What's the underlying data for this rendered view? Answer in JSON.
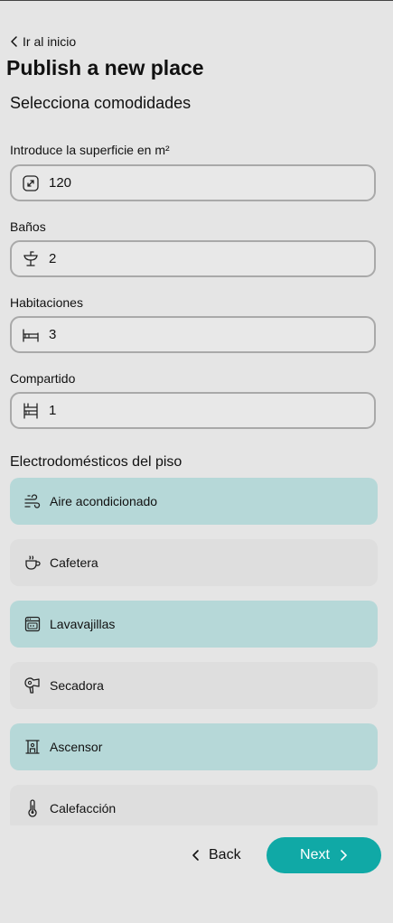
{
  "nav": {
    "back_home_label": "Ir al inicio"
  },
  "page_title": "Publish a new place",
  "subtitle": "Selecciona comodidades",
  "fields": {
    "surface": {
      "label": "Introduce la superficie en m²",
      "value": "120",
      "icon": "resize-icon"
    },
    "bathrooms": {
      "label": "Baños",
      "value": "2",
      "icon": "sink-icon"
    },
    "rooms": {
      "label": "Habitaciones",
      "value": "3",
      "icon": "bed-icon"
    },
    "shared": {
      "label": "Compartido",
      "value": "1",
      "icon": "bunk-bed-icon"
    }
  },
  "appliances": {
    "section_label": "Electrodomésticos del piso",
    "items": [
      {
        "label": "Aire acondicionado",
        "icon": "wind-icon",
        "selected": true
      },
      {
        "label": "Cafetera",
        "icon": "coffee-cup-icon",
        "selected": false
      },
      {
        "label": "Lavavajillas",
        "icon": "dishwasher-icon",
        "selected": true
      },
      {
        "label": "Secadora",
        "icon": "hair-dryer-icon",
        "selected": false
      },
      {
        "label": "Ascensor",
        "icon": "elevator-icon",
        "selected": true
      },
      {
        "label": "Calefacción",
        "icon": "thermometer-icon",
        "selected": false
      }
    ]
  },
  "footer": {
    "back_label": "Back",
    "next_label": "Next"
  },
  "colors": {
    "selected_bg": "#b6d8d8",
    "unselected_bg": "#dedede",
    "accent": "#10a9a6",
    "page_bg": "#e5e5e5"
  }
}
